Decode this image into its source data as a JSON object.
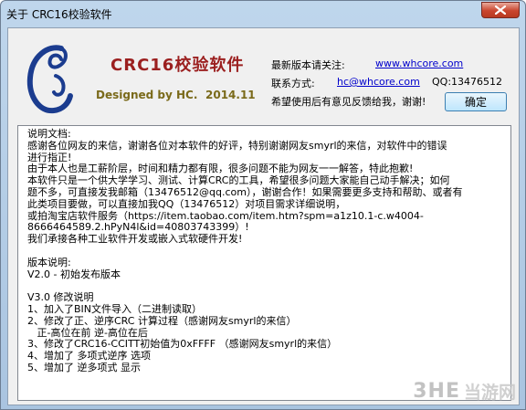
{
  "window": {
    "title": "关于 CRC16校验软件"
  },
  "header": {
    "app_title": "CRC16校验软件",
    "designed_by": "Designed by HC.",
    "date": "2014.11"
  },
  "info": {
    "latest_label": "最新版本请关注:",
    "website": "www.whcore.com",
    "contact_label": "联系方式:",
    "email": "hc@whcore.com",
    "qq": "QQ:13476512",
    "feedback": "希望使用后有意见反馈给我，谢谢!",
    "ok_label": "确定"
  },
  "notes": {
    "lines": [
      "说明文档:",
      "感谢各位网友的来信，谢谢各位对本软件的好评，特别谢谢网友smyrl的来信，对软件中的错误",
      "进行指正!",
      "由于本人也是工薪阶层，时间和精力都有限，很多问题不能为网友一一解答，特此抱歉!",
      "本软件只是一个供大学学习、测试、计算CRC的工具，希望很多问题大家能自己动手解决；如何",
      "题不多，可直接发我邮箱（13476512@qq.com），谢谢合作！如果需要更多支持和帮助、或者有",
      "此类项目要做，可以直接加我QQ（13476512）对项目需求详细说明，",
      "或拍淘宝店软件服务（https://item.taobao.com/item.htm?spm=a1z10.1-c.w4004-",
      "8666464589.2.hPyN4l&id=40803743399）!",
      "我们承接各种工业软件开发或嵌入式软硬件开发!",
      "",
      "版本说明:",
      "V2.0 - 初始发布版本",
      "",
      "V3.0 修改说明",
      "1、加入了BIN文件导入（二进制读取）",
      "2、修改了正、逆序CRC 计算过程（感谢网友smyrl的来信）",
      "   正-高位在前 逆-高位在后",
      "3、修改了CRC16-CCITT初始值为0xFFFF （感谢网友smyrl的来信）",
      "4、增加了 多项式逆序 选项",
      "5、增加了 逆多项式 显示"
    ]
  },
  "watermark": {
    "logo": "3HE",
    "text": "当游网"
  },
  "colors": {
    "app_title": "#9b1f1f",
    "designed": "#7a6a1a",
    "link": "#0000cc"
  }
}
